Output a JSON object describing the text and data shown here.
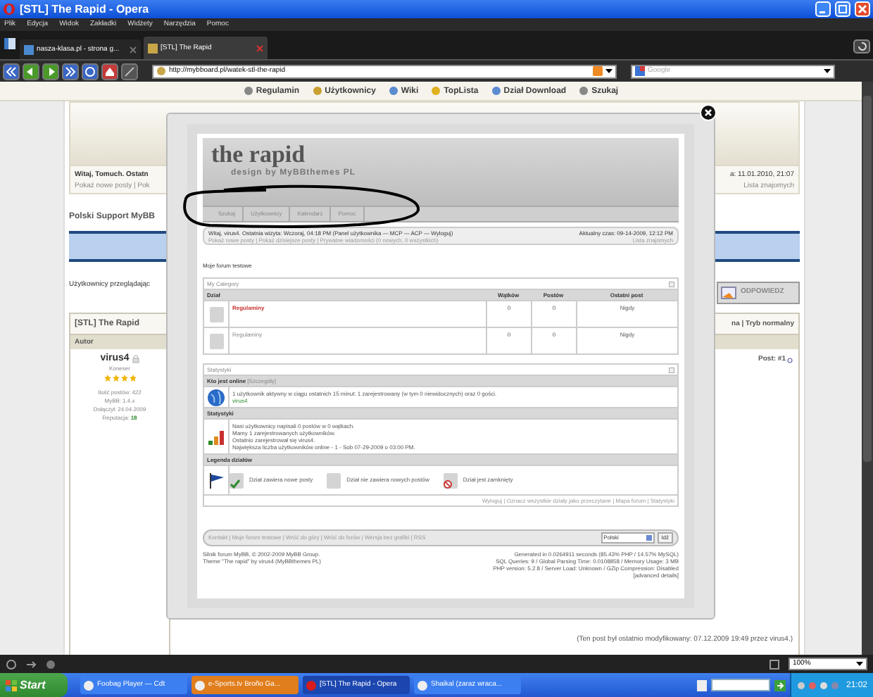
{
  "window": {
    "title": "[STL] The Rapid - Opera"
  },
  "menu": [
    "Plik",
    "Edycja",
    "Widok",
    "Zakładki",
    "Widżety",
    "Narzędzia",
    "Pomoc"
  ],
  "tabs": [
    {
      "label": "nasza-klasa.pl - strona g...",
      "selected": false
    },
    {
      "label": "[STL] The Rapid",
      "selected": true
    }
  ],
  "address": {
    "value": "http://mybboard.pl/watek-stl-the-rapid"
  },
  "search": {
    "placeholder": "Google"
  },
  "site_nav": [
    "Regulamin",
    "Użytkownicy",
    "Wiki",
    "TopLista",
    "Dział Download",
    "Szukaj"
  ],
  "forum": {
    "welcome_left": [
      "Witaj, Tomuch. Ostatn",
      "Pokaż nowe posty | Pok"
    ],
    "welcome_right": [
      "a: 11.01.2010, 21:07",
      "Lista znajomych"
    ],
    "title": "Polski Support MyBB",
    "viewers": "Użytkownicy przeglądając",
    "reply_button": "ODPOWIEDZ",
    "thread_title": "[STL] The Rapid",
    "modes": "na | Tryb normalny",
    "author_header": "Autor",
    "author": {
      "name": "virus4",
      "rank": "Koneser",
      "stars": 4,
      "stats": [
        {
          "label": "Ilość postów:",
          "value": "422",
          "highlight": false
        },
        {
          "label": "MyBB:",
          "value": "1.4.x",
          "highlight": false
        },
        {
          "label": "Dołączył:",
          "value": "24.04.2009",
          "highlight": false
        },
        {
          "label": "Reputacja:",
          "value": "18",
          "highlight": true
        }
      ]
    },
    "post_number": "Post: #1",
    "edited": "(Ten post był ostatnio modyfikowany: 07.12.2009 19:49 przez virus4.)"
  },
  "screenshot": {
    "logo": "the rapid",
    "tagline": "design by MyBBthemes PL",
    "nav": [
      "Szukaj",
      "Użytkownicy",
      "Kalendarz",
      "Pomoc"
    ],
    "welcome": "Witaj, virus4. Ostatnia wizyta: Wczoraj, 04:18 PM (Panel użytkownika — MCP — ACP — Wyloguj)",
    "welcome_links": "Pokaż nowe posty | Pokaż dzisiejsze posty | Prywatne wiadomości (0 nowych, 0 wszystkich)",
    "time": "Aktualny czas: 09-14-2009, 12:12 PM",
    "friends": "Lista znajomych",
    "forum_title": "Moje forum testowe",
    "category": {
      "title": "My Category",
      "columns": [
        "Dział",
        "Wątków",
        "Postów",
        "Ostatni post"
      ],
      "rows": [
        {
          "name": "Regulaminy",
          "highlighted": true,
          "threads": "0",
          "posts": "0",
          "last": "Nigdy"
        },
        {
          "name": "Regulaminy",
          "highlighted": false,
          "threads": "0",
          "posts": "0",
          "last": "Nigdy"
        }
      ]
    },
    "stats": {
      "title": "Statystyki",
      "online_heading": "Kto jest online",
      "online_link": "[Szczegóły]",
      "online_text": "1 użytkownik aktywny w ciągu ostatnich 15 minut: 1 zarejestrowany (w tym 0 niewidocznych) oraz 0 gości.",
      "online_users": "virus4",
      "stats_heading": "Statystyki",
      "stats_lines": [
        "Nasi użytkownicy napisali 0 postów w 0 wątkach.",
        "Mamy 1 zarejestrowanych użytkowników.",
        "Ostatnio zarejestrował się virus4.",
        "Największa liczba użytkowników online - 1 - Sob 07-29-2009 o 03:00 PM."
      ],
      "legend_heading": "Legenda działów",
      "legend": [
        "Dział zawiera nowe posty",
        "Dział nie zawiera nowych postów",
        "Dział jest zamknięty"
      ],
      "links": "Wyloguj | Oznacz wszystkie działy jako przeczytane | Mapa forum | Statystyki"
    },
    "bottom_links": "Kontakt | Moje forum testowe | Wróć do góry | Wróć do forów | Wersja bez grafiki | RSS",
    "language": "Polski",
    "go_button": "Idź",
    "credits": [
      "Silnik forum MyBB, © 2002-2009 MyBB Group.",
      "Theme \"The rapid\" by virus4 (MyBBthemes PL)"
    ],
    "debug": [
      "Generated in 0.0264911 seconds (85.43% PHP / 14.57% MySQL)",
      "SQL Queries: 9 / Global Parsing Time: 0.0108858 / Memory Usage: 3 MB",
      "PHP version: 5.2.8 / Server Load: Unknown / GZip Compression: Disabled",
      "[advanced details]"
    ]
  },
  "status_bar": {
    "zoom": "100%"
  },
  "taskbar": {
    "start": "Start",
    "tasks": [
      {
        "label": "Foobag Player — Cdt",
        "selected": false,
        "flashing": false
      },
      {
        "label": "e-Sports.tv Broño Ga...",
        "selected": false,
        "flashing": true
      },
      {
        "label": "[STL] The Rapid - Opera",
        "selected": true,
        "flashing": false
      },
      {
        "label": "Shaikal (zaraz wraca...",
        "selected": false,
        "flashing": false
      }
    ],
    "clock": "21:02"
  }
}
